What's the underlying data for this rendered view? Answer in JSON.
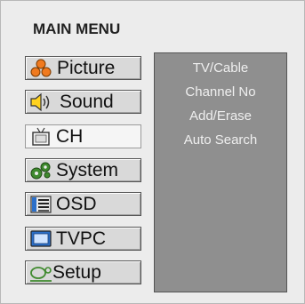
{
  "menu": {
    "title": "MAIN MENU",
    "items": [
      {
        "label": "Picture",
        "icon": "picture-icon"
      },
      {
        "label": "Sound",
        "icon": "speaker-icon"
      },
      {
        "label": "CH",
        "icon": "tv-icon"
      },
      {
        "label": "System",
        "icon": "gears-icon"
      },
      {
        "label": "OSD",
        "icon": "osd-list-icon"
      },
      {
        "label": "TVPC",
        "icon": "monitor-icon"
      },
      {
        "label": "Setup",
        "icon": "setup-icon"
      }
    ],
    "selected": "CH"
  },
  "submenu": {
    "options": [
      "TV/Cable",
      "Channel No",
      "Add/Erase",
      "Auto Search"
    ]
  },
  "colors": {
    "background": "#ececec",
    "button_face": "#d9d9d9",
    "selected_face": "#f5f5f5",
    "panel": "#8f8f8f",
    "panel_text": "#efefef",
    "icon_orange": "#f07a1f",
    "icon_yellow": "#ffd21f",
    "icon_green": "#3f8a2e",
    "icon_blue": "#2b6fc9"
  }
}
